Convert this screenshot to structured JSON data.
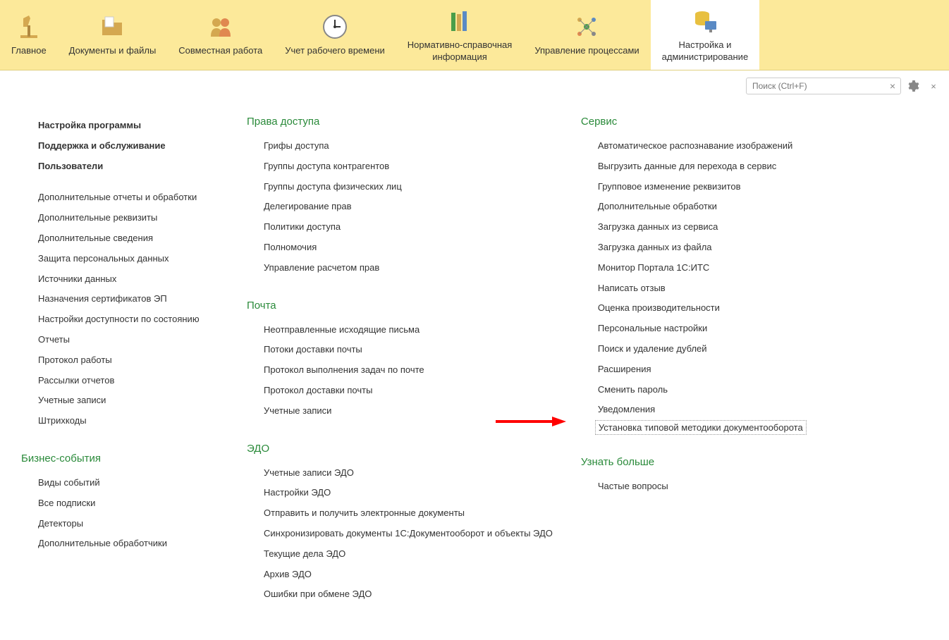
{
  "nav": [
    {
      "label": "Главное"
    },
    {
      "label": "Документы и файлы"
    },
    {
      "label": "Совместная работа"
    },
    {
      "label": "Учет рабочего времени"
    },
    {
      "label": "Нормативно-справочная\nинформация"
    },
    {
      "label": "Управление процессами"
    },
    {
      "label": "Настройка и\nадминистрирование"
    }
  ],
  "search": {
    "placeholder": "Поиск (Ctrl+F)"
  },
  "col1": {
    "bold_items": [
      "Настройка программы",
      "Поддержка и обслуживание",
      "Пользователи"
    ],
    "items": [
      "Дополнительные отчеты и обработки",
      "Дополнительные реквизиты",
      "Дополнительные сведения",
      "Защита персональных данных",
      "Источники данных",
      "Назначения сертификатов ЭП",
      "Настройки доступности по состоянию",
      "Отчеты",
      "Протокол работы",
      "Рассылки отчетов",
      "Учетные записи",
      "Штрихкоды"
    ],
    "biz_header": "Бизнес-события",
    "biz_items": [
      "Виды событий",
      "Все подписки",
      "Детекторы",
      "Дополнительные обработчики"
    ]
  },
  "col2": {
    "access_header": "Права доступа",
    "access_items": [
      "Грифы доступа",
      "Группы доступа контрагентов",
      "Группы доступа физических лиц",
      "Делегирование прав",
      "Политики доступа",
      "Полномочия",
      "Управление расчетом прав"
    ],
    "mail_header": "Почта",
    "mail_items": [
      "Неотправленные исходящие письма",
      "Потоки доставки почты",
      "Протокол выполнения задач по почте",
      "Протокол доставки почты",
      "Учетные записи"
    ],
    "edo_header": "ЭДО",
    "edo_items": [
      "Учетные записи ЭДО",
      "Настройки ЭДО",
      "Отправить и получить электронные документы",
      "Синхронизировать документы 1С:Документооборот и объекты ЭДО",
      "Текущие дела ЭДО",
      "Архив ЭДО",
      "Ошибки при обмене ЭДО"
    ]
  },
  "col3": {
    "service_header": "Сервис",
    "service_items": [
      "Автоматическое распознавание изображений",
      "Выгрузить данные для перехода в сервис",
      "Групповое изменение реквизитов",
      "Дополнительные обработки",
      "Загрузка данных из сервиса",
      "Загрузка данных из файла",
      "Монитор Портала 1С:ИТС",
      "Написать отзыв",
      "Оценка производительности",
      "Персональные настройки",
      "Поиск и удаление дублей",
      "Расширения",
      "Сменить пароль",
      "Уведомления"
    ],
    "highlighted_item": "Установка типовой методики документооборота",
    "more_header": "Узнать больше",
    "more_items": [
      "Частые вопросы"
    ]
  }
}
